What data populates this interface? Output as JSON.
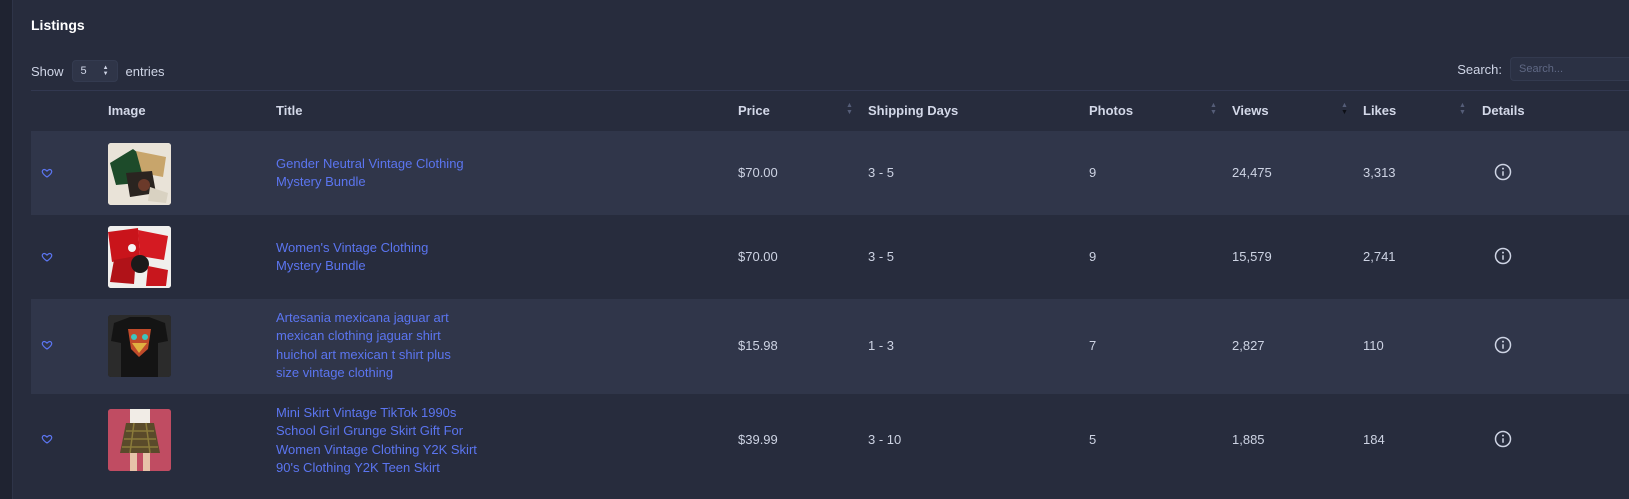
{
  "panel": {
    "title": "Listings"
  },
  "controls": {
    "show_label": "Show",
    "page_size": "5",
    "entries_label": "entries",
    "search_label": "Search:",
    "search_placeholder": "Search..."
  },
  "columns": {
    "image": "Image",
    "title": "Title",
    "price": "Price",
    "shipping": "Shipping Days",
    "photos": "Photos",
    "views": "Views",
    "likes": "Likes",
    "details": "Details"
  },
  "rows": [
    {
      "title_lines": [
        "Gender Neutral Vintage Clothing",
        "Mystery Bundle"
      ],
      "price": "$70.00",
      "shipping": "3 - 5",
      "photos": "9",
      "views": "24,475",
      "likes": "3,313"
    },
    {
      "title_lines": [
        "Women's Vintage Clothing",
        "Mystery Bundle"
      ],
      "price": "$70.00",
      "shipping": "3 - 5",
      "photos": "9",
      "views": "15,579",
      "likes": "2,741"
    },
    {
      "title_lines": [
        "Artesania mexicana jaguar art",
        "mexican clothing jaguar shirt",
        "huichol art mexican t shirt plus",
        "size vintage clothing"
      ],
      "price": "$15.98",
      "shipping": "1 - 3",
      "photos": "7",
      "views": "2,827",
      "likes": "110"
    },
    {
      "title_lines": [
        "Mini Skirt Vintage TikTok 1990s",
        "School Girl Grunge Skirt Gift For",
        "Women Vintage Clothing Y2K Skirt",
        "90's Clothing Y2K Teen Skirt"
      ],
      "price": "$39.99",
      "shipping": "3 - 10",
      "photos": "5",
      "views": "1,885",
      "likes": "184"
    }
  ],
  "icons": {
    "favorite": "heart-icon",
    "details": "info-circle-icon",
    "sort": "sort-icon"
  },
  "colors": {
    "link": "#5b75f0",
    "background": "#272c3d",
    "row_alt": "#30364a"
  }
}
